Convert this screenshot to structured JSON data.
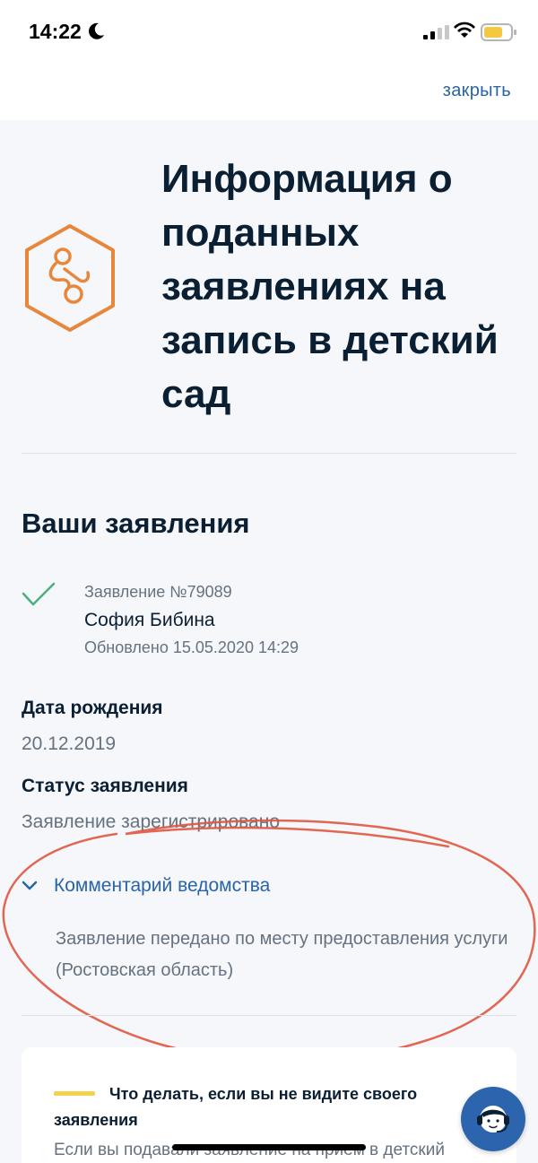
{
  "status_bar": {
    "time": "14:22"
  },
  "header": {
    "close_label": "закрыть"
  },
  "page": {
    "title": "Информация о поданных заявлениях на запись в детский сад",
    "hero_icon": "pacifier-icon",
    "accent_color": "#e8873b"
  },
  "applications": {
    "section_title": "Ваши заявления",
    "item": {
      "number": "Заявление №79089",
      "name": "София Бибина",
      "updated": "Обновлено 15.05.2020 14:29",
      "status_icon": "check-icon"
    }
  },
  "details": {
    "birth_date_label": "Дата рождения",
    "birth_date_value": "20.12.2019",
    "status_label": "Статус заявления",
    "status_value": "Заявление зарегистрировано",
    "comment_toggle_label": "Комментарий ведомства",
    "comment_text": "Заявление передано по месту предоставления услуги (Ростовская область)"
  },
  "info_card": {
    "title": "Что делать, если вы не видите своего заявления",
    "text": "Если вы подавали заявление на прием в детский"
  },
  "support": {
    "icon": "support-operator-icon"
  },
  "colors": {
    "link": "#2964a8",
    "success": "#4caf7d",
    "annotation": "#e0573f",
    "support_button": "#2c65ad"
  }
}
